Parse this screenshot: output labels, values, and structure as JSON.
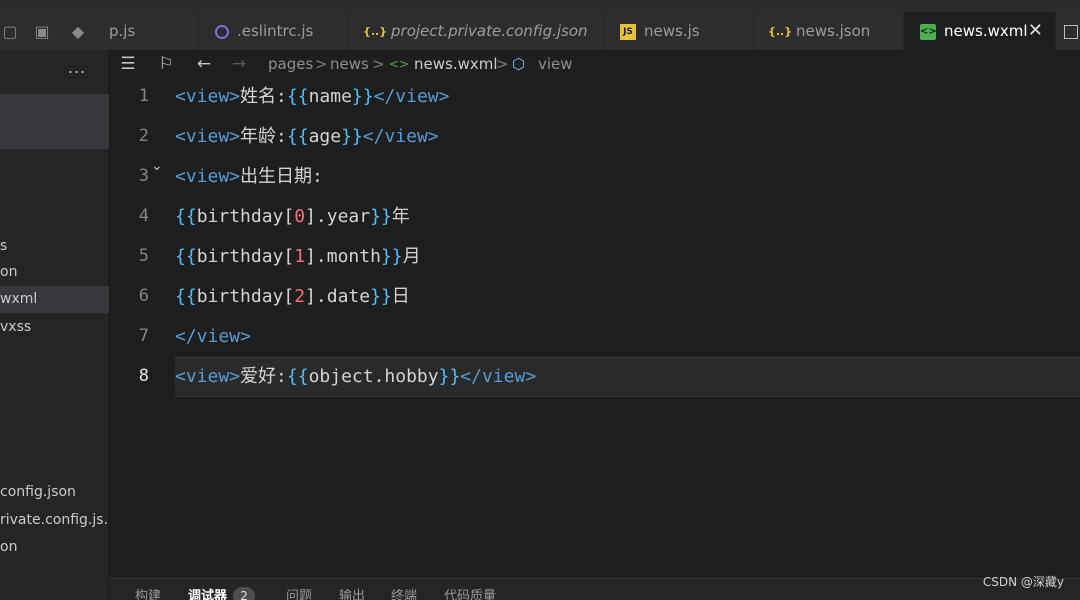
{
  "sidebar": {
    "more_label": "...",
    "files": [
      {
        "label": "s"
      },
      {
        "label": "on"
      },
      {
        "label": "wxml"
      },
      {
        "label": "vxss"
      },
      {
        "label": "config.json"
      },
      {
        "label": "rivate.config.js..."
      },
      {
        "label": "on"
      }
    ]
  },
  "tabs": [
    {
      "label": "p.js",
      "icon": "js-icon"
    },
    {
      "label": ".eslintrc.js",
      "icon": "eslint-icon"
    },
    {
      "label": "project.private.config.json",
      "icon": "json-icon"
    },
    {
      "label": "news.js",
      "icon": "js-icon"
    },
    {
      "label": "news.json",
      "icon": "json-icon"
    },
    {
      "label": "news.wxml",
      "icon": "wxml-icon",
      "close": "✕"
    }
  ],
  "breadcrumb": {
    "items": [
      "pages",
      "news",
      "news.wxml",
      "view"
    ],
    "separator": ">"
  },
  "editor": {
    "lines": [
      {
        "num": "1",
        "code": "<view>姓名:{{name}}</view>"
      },
      {
        "num": "2",
        "code": "<view>年龄:{{age}}</view>"
      },
      {
        "num": "3",
        "code": "<view>出生日期:"
      },
      {
        "num": "4",
        "code": "{{birthday[0].year}}年"
      },
      {
        "num": "5",
        "code": "{{birthday[1].month}}月"
      },
      {
        "num": "6",
        "code": "{{birthday[2].date}}日"
      },
      {
        "num": "7",
        "code": "</view>"
      },
      {
        "num": "8",
        "code": "<view>爱好:{{object.hobby}}</view>"
      }
    ],
    "current_line": "8"
  },
  "panel": {
    "tabs": [
      "构建",
      "调试器",
      "问题",
      "输出",
      "终端",
      "代码质量"
    ],
    "debugger_badge": "2"
  },
  "watermark": "CSDN @深藏y",
  "colors": {
    "tag": "#569cd6",
    "brace": "#4fc1ff",
    "number": "#f07178",
    "text": "#d4d4d4",
    "background": "#1e1e1e"
  }
}
